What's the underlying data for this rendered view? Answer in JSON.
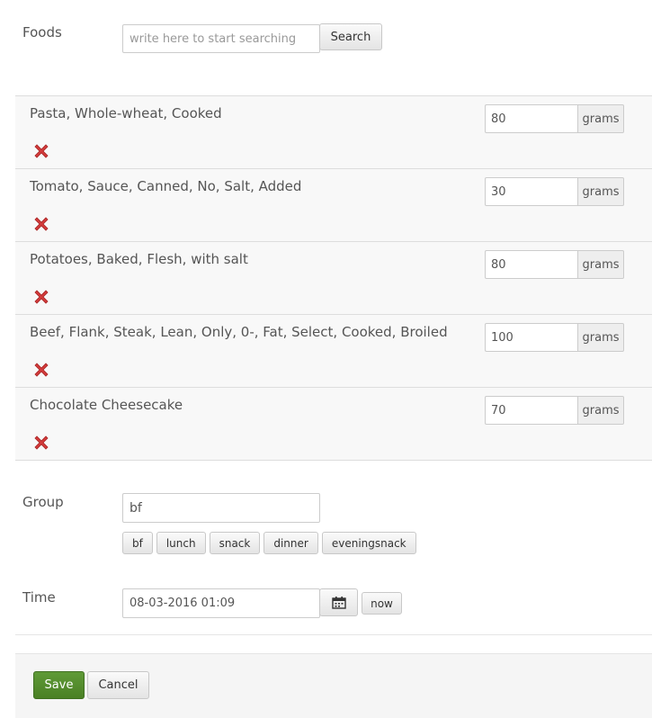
{
  "foods_section": {
    "label": "Foods",
    "search_placeholder": "write here to start searching",
    "search_button": "Search"
  },
  "foods": [
    {
      "name": "Pasta, Whole-wheat, Cooked",
      "amount": "80",
      "unit": "grams"
    },
    {
      "name": "Tomato, Sauce, Canned, No, Salt, Added",
      "amount": "30",
      "unit": "grams"
    },
    {
      "name": "Potatoes, Baked, Flesh, with salt",
      "amount": "80",
      "unit": "grams"
    },
    {
      "name": "Beef, Flank, Steak, Lean, Only, 0-, Fat, Select, Cooked, Broiled",
      "amount": "100",
      "unit": "grams"
    },
    {
      "name": "Chocolate Cheesecake",
      "amount": "70",
      "unit": "grams"
    }
  ],
  "group": {
    "label": "Group",
    "value": "bf",
    "options": [
      "bf",
      "lunch",
      "snack",
      "dinner",
      "eveningsnack"
    ]
  },
  "time": {
    "label": "Time",
    "value": "08-03-2016 01:09",
    "now_button": "now",
    "calendar_icon": "calendar-icon"
  },
  "actions": {
    "save": "Save",
    "cancel": "Cancel"
  },
  "colors": {
    "save_bg": "#4f8a29",
    "delete_icon": "#d23b3b",
    "row_bg": "#f8f8f8"
  }
}
